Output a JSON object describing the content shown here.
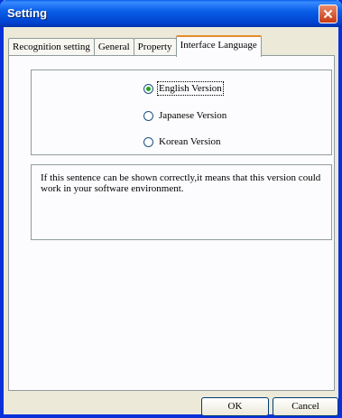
{
  "window": {
    "title": "Setting"
  },
  "tabs": [
    {
      "label": "Recognition setting"
    },
    {
      "label": "General"
    },
    {
      "label": "Property"
    },
    {
      "label": "Interface Language",
      "active": true
    }
  ],
  "language": {
    "options": [
      {
        "label": "English Version",
        "checked": true
      },
      {
        "label": "Japanese Version",
        "checked": false
      },
      {
        "label": "Korean Version",
        "checked": false
      }
    ]
  },
  "message": "If this sentence can be shown correctly,it means that this version could work in your software environment.",
  "buttons": {
    "ok": "OK",
    "cancel": "Cancel"
  },
  "colors": {
    "titlebar": "#0a5fe8",
    "close": "#c73a14",
    "dialog": "#ece9d8",
    "active_tab_accent": "#e68b2c"
  }
}
